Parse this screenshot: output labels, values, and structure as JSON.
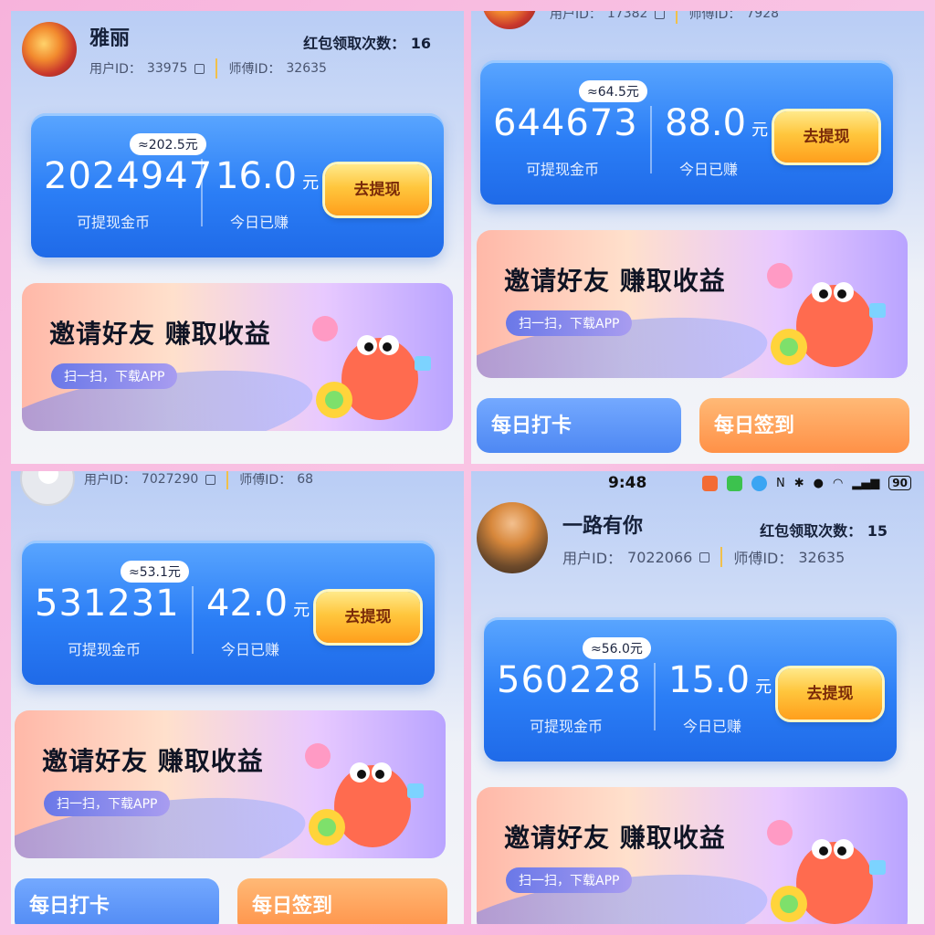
{
  "panels": [
    {
      "name": "雅丽",
      "redpack": "红包领取次数：",
      "redpack_count": "16",
      "user_id_label": "用户ID：",
      "user_id": "33975",
      "master_id_label": "师傅ID：",
      "master_id": "32635",
      "approx": "≈202.5元",
      "coins": "2024947",
      "coins_label": "可提现金币",
      "today": "16.0",
      "yuan": "元",
      "today_label": "今日已赚",
      "withdraw": "去提现",
      "invite_title": "邀请好友  赚取收益",
      "invite_sub": "扫一扫，下载APP"
    },
    {
      "user_id_label": "用户ID：",
      "user_id": "17382",
      "master_id_label": "师傅ID：",
      "master_id": "7928",
      "approx": "≈64.5元",
      "coins": "644673",
      "coins_label": "可提现金币",
      "today": "88.0",
      "yuan": "元",
      "today_label": "今日已赚",
      "withdraw": "去提现",
      "invite_title": "邀请好友  赚取收益",
      "invite_sub": "扫一扫，下载APP",
      "tab_checkin": "每日打卡",
      "tab_sign": "每日签到"
    },
    {
      "user_id_label": "用户ID：",
      "user_id": "7027290",
      "master_id_label": "师傅ID：",
      "master_id": "68",
      "approx": "≈53.1元",
      "coins": "531231",
      "coins_label": "可提现金币",
      "today": "42.0",
      "yuan": "元",
      "today_label": "今日已赚",
      "withdraw": "去提现",
      "invite_title": "邀请好友  赚取收益",
      "invite_sub": "扫一扫，下载APP",
      "tab_checkin": "每日打卡",
      "tab_sign": "每日签到"
    },
    {
      "status_time": "9:48",
      "battery": "90",
      "name": "一路有你",
      "redpack": "红包领取次数：",
      "redpack_count": "15",
      "user_id_label": "用户ID：",
      "user_id": "7022066",
      "master_id_label": "师傅ID：",
      "master_id": "32635",
      "approx": "≈56.0元",
      "coins": "560228",
      "coins_label": "可提现金币",
      "today": "15.0",
      "yuan": "元",
      "today_label": "今日已赚",
      "withdraw": "去提现",
      "invite_title": "邀请好友  赚取收益",
      "invite_sub": "扫一扫，下载APP"
    }
  ],
  "icons": {
    "copy": "copy-icon",
    "mascot": "mascot-icon"
  },
  "colors": {
    "card_blue": "#2b7ef6",
    "button_gold": "#ffc63d",
    "frame_pink": "#f7b3dc"
  }
}
